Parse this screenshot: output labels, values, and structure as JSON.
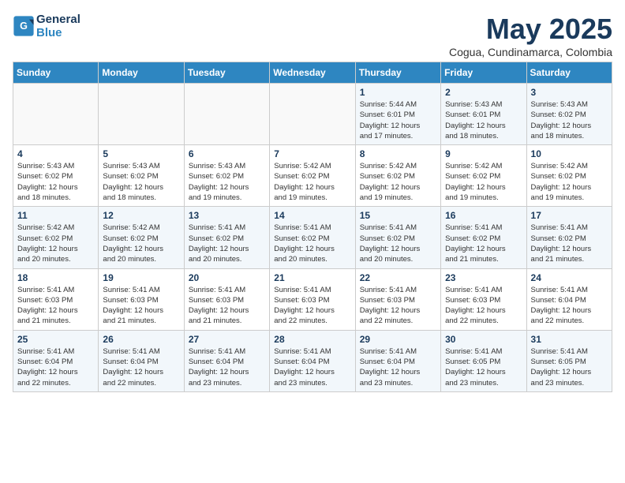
{
  "logo": {
    "line1": "General",
    "line2": "Blue"
  },
  "title": "May 2025",
  "location": "Cogua, Cundinamarca, Colombia",
  "weekdays": [
    "Sunday",
    "Monday",
    "Tuesday",
    "Wednesday",
    "Thursday",
    "Friday",
    "Saturday"
  ],
  "weeks": [
    [
      {
        "day": "",
        "info": ""
      },
      {
        "day": "",
        "info": ""
      },
      {
        "day": "",
        "info": ""
      },
      {
        "day": "",
        "info": ""
      },
      {
        "day": "1",
        "info": "Sunrise: 5:44 AM\nSunset: 6:01 PM\nDaylight: 12 hours\nand 17 minutes."
      },
      {
        "day": "2",
        "info": "Sunrise: 5:43 AM\nSunset: 6:01 PM\nDaylight: 12 hours\nand 18 minutes."
      },
      {
        "day": "3",
        "info": "Sunrise: 5:43 AM\nSunset: 6:02 PM\nDaylight: 12 hours\nand 18 minutes."
      }
    ],
    [
      {
        "day": "4",
        "info": "Sunrise: 5:43 AM\nSunset: 6:02 PM\nDaylight: 12 hours\nand 18 minutes."
      },
      {
        "day": "5",
        "info": "Sunrise: 5:43 AM\nSunset: 6:02 PM\nDaylight: 12 hours\nand 18 minutes."
      },
      {
        "day": "6",
        "info": "Sunrise: 5:43 AM\nSunset: 6:02 PM\nDaylight: 12 hours\nand 19 minutes."
      },
      {
        "day": "7",
        "info": "Sunrise: 5:42 AM\nSunset: 6:02 PM\nDaylight: 12 hours\nand 19 minutes."
      },
      {
        "day": "8",
        "info": "Sunrise: 5:42 AM\nSunset: 6:02 PM\nDaylight: 12 hours\nand 19 minutes."
      },
      {
        "day": "9",
        "info": "Sunrise: 5:42 AM\nSunset: 6:02 PM\nDaylight: 12 hours\nand 19 minutes."
      },
      {
        "day": "10",
        "info": "Sunrise: 5:42 AM\nSunset: 6:02 PM\nDaylight: 12 hours\nand 19 minutes."
      }
    ],
    [
      {
        "day": "11",
        "info": "Sunrise: 5:42 AM\nSunset: 6:02 PM\nDaylight: 12 hours\nand 20 minutes."
      },
      {
        "day": "12",
        "info": "Sunrise: 5:42 AM\nSunset: 6:02 PM\nDaylight: 12 hours\nand 20 minutes."
      },
      {
        "day": "13",
        "info": "Sunrise: 5:41 AM\nSunset: 6:02 PM\nDaylight: 12 hours\nand 20 minutes."
      },
      {
        "day": "14",
        "info": "Sunrise: 5:41 AM\nSunset: 6:02 PM\nDaylight: 12 hours\nand 20 minutes."
      },
      {
        "day": "15",
        "info": "Sunrise: 5:41 AM\nSunset: 6:02 PM\nDaylight: 12 hours\nand 20 minutes."
      },
      {
        "day": "16",
        "info": "Sunrise: 5:41 AM\nSunset: 6:02 PM\nDaylight: 12 hours\nand 21 minutes."
      },
      {
        "day": "17",
        "info": "Sunrise: 5:41 AM\nSunset: 6:02 PM\nDaylight: 12 hours\nand 21 minutes."
      }
    ],
    [
      {
        "day": "18",
        "info": "Sunrise: 5:41 AM\nSunset: 6:03 PM\nDaylight: 12 hours\nand 21 minutes."
      },
      {
        "day": "19",
        "info": "Sunrise: 5:41 AM\nSunset: 6:03 PM\nDaylight: 12 hours\nand 21 minutes."
      },
      {
        "day": "20",
        "info": "Sunrise: 5:41 AM\nSunset: 6:03 PM\nDaylight: 12 hours\nand 21 minutes."
      },
      {
        "day": "21",
        "info": "Sunrise: 5:41 AM\nSunset: 6:03 PM\nDaylight: 12 hours\nand 22 minutes."
      },
      {
        "day": "22",
        "info": "Sunrise: 5:41 AM\nSunset: 6:03 PM\nDaylight: 12 hours\nand 22 minutes."
      },
      {
        "day": "23",
        "info": "Sunrise: 5:41 AM\nSunset: 6:03 PM\nDaylight: 12 hours\nand 22 minutes."
      },
      {
        "day": "24",
        "info": "Sunrise: 5:41 AM\nSunset: 6:04 PM\nDaylight: 12 hours\nand 22 minutes."
      }
    ],
    [
      {
        "day": "25",
        "info": "Sunrise: 5:41 AM\nSunset: 6:04 PM\nDaylight: 12 hours\nand 22 minutes."
      },
      {
        "day": "26",
        "info": "Sunrise: 5:41 AM\nSunset: 6:04 PM\nDaylight: 12 hours\nand 22 minutes."
      },
      {
        "day": "27",
        "info": "Sunrise: 5:41 AM\nSunset: 6:04 PM\nDaylight: 12 hours\nand 23 minutes."
      },
      {
        "day": "28",
        "info": "Sunrise: 5:41 AM\nSunset: 6:04 PM\nDaylight: 12 hours\nand 23 minutes."
      },
      {
        "day": "29",
        "info": "Sunrise: 5:41 AM\nSunset: 6:04 PM\nDaylight: 12 hours\nand 23 minutes."
      },
      {
        "day": "30",
        "info": "Sunrise: 5:41 AM\nSunset: 6:05 PM\nDaylight: 12 hours\nand 23 minutes."
      },
      {
        "day": "31",
        "info": "Sunrise: 5:41 AM\nSunset: 6:05 PM\nDaylight: 12 hours\nand 23 minutes."
      }
    ]
  ]
}
